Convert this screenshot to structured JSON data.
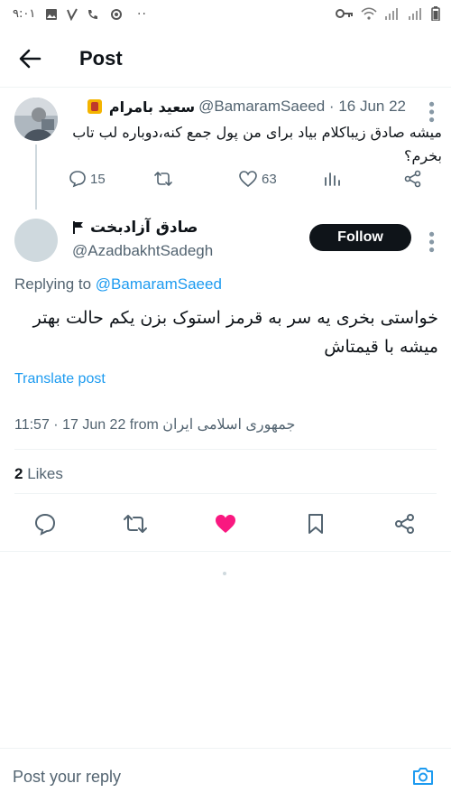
{
  "status_bar": {
    "time": "۹:۰۱",
    "dots": "··"
  },
  "header": {
    "title": "Post",
    "back_icon": "arrow-left-icon"
  },
  "parent_tweet": {
    "display_name": "سعید بامرام",
    "handle_date": "@BamaramSaeed · 16 Jun 22",
    "text": "میشه صادق زیباکلام بیاد برای من پول جمع کنه،دوباره لب تاب بخرم؟",
    "replies": "15",
    "likes": "63"
  },
  "main_tweet": {
    "display_name": "صادق آزادبخت",
    "handle": "@AzadbakhtSadegh",
    "follow_label": "Follow",
    "replying_prefix": "Replying to",
    "replying_to": "@BamaramSaeed",
    "text": "خواستی بخری یه سر به قرمز استوک بزن یکم حالت بهتر میشه با قیمتاش",
    "translate_label": "Translate post",
    "meta": "11:57 · 17 Jun 22 from جمهوری اسلامی ایران",
    "likes_count": "2",
    "likes_label": "Likes",
    "liked": true
  },
  "reply_bar": {
    "placeholder": "Post your reply",
    "camera_icon": "camera-icon"
  },
  "colors": {
    "accent": "#1d9bf0",
    "like_active": "#f91880",
    "text_secondary": "#536471",
    "follow_bg": "#0f1419"
  }
}
